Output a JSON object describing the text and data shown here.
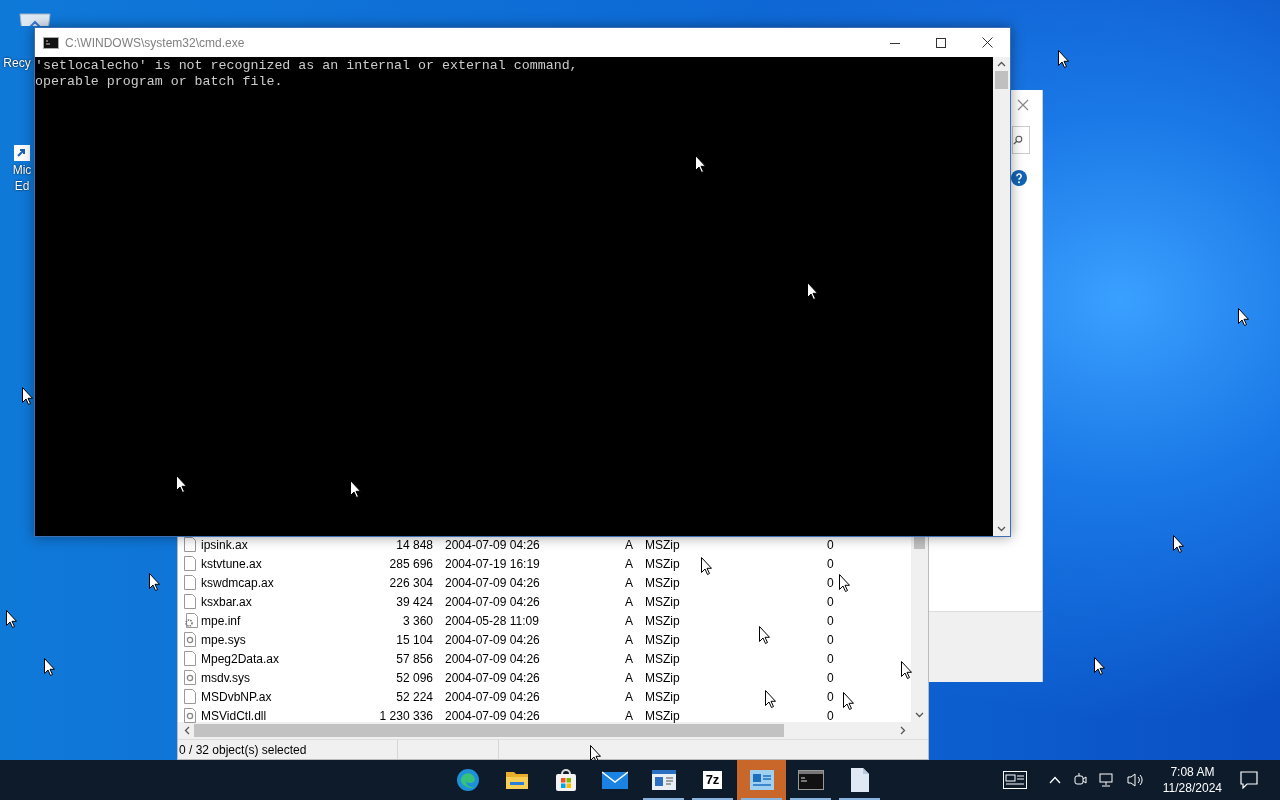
{
  "desktop_icons": [
    {
      "kind": "recycle",
      "lines": [
        "Recy"
      ]
    },
    {
      "kind": "shortcut",
      "lines": [
        "Mic",
        "Ed"
      ]
    }
  ],
  "cmd_window": {
    "title": "C:\\WINDOWS\\system32\\cmd.exe",
    "lines": [
      "'setlocalecho' is not recognized as an internal or external command,",
      "operable program or batch file."
    ]
  },
  "file_list": {
    "rows": [
      {
        "kind": "file",
        "name": "ipsink.ax",
        "size": "14 848",
        "modified": "2004-07-09 04:26",
        "attributes": "A",
        "method": "MSZip",
        "column_6": "0"
      },
      {
        "kind": "file",
        "name": "kstvtune.ax",
        "size": "285 696",
        "modified": "2004-07-19 16:19",
        "attributes": "A",
        "method": "MSZip",
        "column_6": "0"
      },
      {
        "kind": "file",
        "name": "kswdmcap.ax",
        "size": "226 304",
        "modified": "2004-07-09 04:26",
        "attributes": "A",
        "method": "MSZip",
        "column_6": "0"
      },
      {
        "kind": "file",
        "name": "ksxbar.ax",
        "size": "39 424",
        "modified": "2004-07-09 04:26",
        "attributes": "A",
        "method": "MSZip",
        "column_6": "0"
      },
      {
        "kind": "settings",
        "name": "mpe.inf",
        "size": "3 360",
        "modified": "2004-05-28 11:09",
        "attributes": "A",
        "method": "MSZip",
        "column_6": "0"
      },
      {
        "kind": "system",
        "name": "mpe.sys",
        "size": "15 104",
        "modified": "2004-07-09 04:26",
        "attributes": "A",
        "method": "MSZip",
        "column_6": "0"
      },
      {
        "kind": "file",
        "name": "Mpeg2Data.ax",
        "size": "57 856",
        "modified": "2004-07-09 04:26",
        "attributes": "A",
        "method": "MSZip",
        "column_6": "0"
      },
      {
        "kind": "system",
        "name": "msdv.sys",
        "size": "52 096",
        "modified": "2004-07-09 04:26",
        "attributes": "A",
        "method": "MSZip",
        "column_6": "0"
      },
      {
        "kind": "file",
        "name": "MSDvbNP.ax",
        "size": "52 224",
        "modified": "2004-07-09 04:26",
        "attributes": "A",
        "method": "MSZip",
        "column_6": "0"
      },
      {
        "kind": "system",
        "name": "MSVidCtl.dll",
        "size": "1 230 336",
        "modified": "2004-07-09 04:26",
        "attributes": "A",
        "method": "MSZip",
        "column_6": "0"
      }
    ],
    "status": "0 / 32 object(s) selected"
  },
  "taskbar": {
    "apps": [
      {
        "kind": "edge",
        "running": false,
        "selected": false
      },
      {
        "kind": "folder",
        "running": false,
        "selected": false
      },
      {
        "kind": "store",
        "running": false,
        "selected": false
      },
      {
        "kind": "mail",
        "running": false,
        "selected": false
      },
      {
        "kind": "window",
        "running": true,
        "selected": false
      },
      {
        "kind": "archiver",
        "label": "7z",
        "running": true,
        "selected": false
      },
      {
        "kind": "viewer",
        "running": true,
        "selected": true
      },
      {
        "kind": "console",
        "running": true,
        "selected": false
      },
      {
        "kind": "document",
        "running": true,
        "selected": false
      }
    ],
    "time": "7:08 AM",
    "date": "11/28/2024"
  }
}
